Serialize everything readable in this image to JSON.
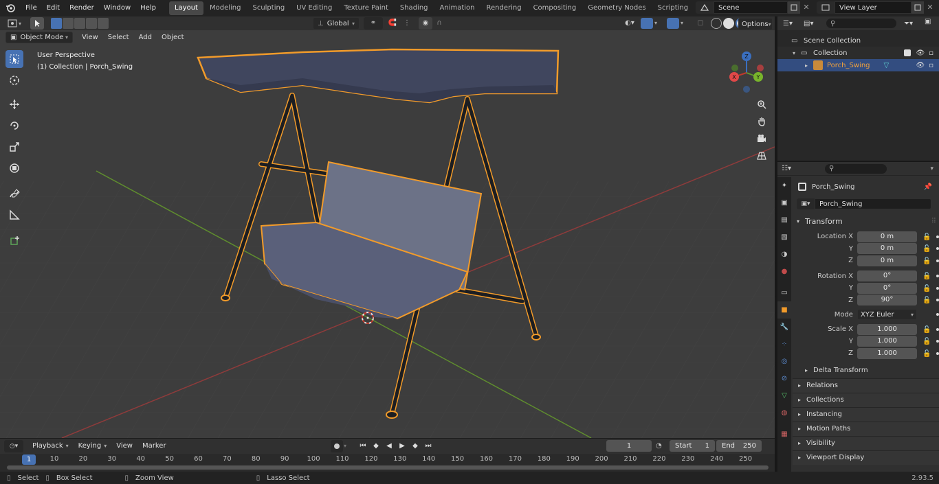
{
  "topbar": {
    "menu": [
      "File",
      "Edit",
      "Render",
      "Window",
      "Help"
    ],
    "workspaces": [
      "Layout",
      "Modeling",
      "Sculpting",
      "UV Editing",
      "Texture Paint",
      "Shading",
      "Animation",
      "Rendering",
      "Compositing",
      "Geometry Nodes",
      "Scripting"
    ],
    "active_workspace": "Layout",
    "scene": "Scene",
    "view_layer": "View Layer"
  },
  "viewport_header": {
    "mode": "Object Mode",
    "menus": [
      "View",
      "Select",
      "Add",
      "Object"
    ],
    "orientation": "Global",
    "options_label": "Options"
  },
  "viewport": {
    "perspective_label": "User Perspective",
    "collection_label": "(1) Collection | Porch_Swing",
    "gizmo_axes": {
      "x": "X",
      "y": "Y",
      "z": "Z"
    },
    "colors": {
      "selection": "#f29b2a",
      "grid_x": "#8f3b3b",
      "grid_y": "#5f8d2e",
      "active_tool": "#4772b3"
    },
    "tools": [
      "select-box",
      "cursor",
      "move",
      "rotate",
      "scale",
      "transform",
      "annotate",
      "measure",
      "add-cube"
    ]
  },
  "outliner": {
    "rows": [
      {
        "label": "Scene Collection"
      },
      {
        "label": "Collection"
      },
      {
        "label": "Porch_Swing"
      }
    ]
  },
  "properties": {
    "object_name": "Porch_Swing",
    "datablock_name": "Porch_Swing",
    "transform_label": "Transform",
    "location_label": "Location X",
    "rotation_label": "Rotation X",
    "scale_label": "Scale X",
    "y_label": "Y",
    "z_label": "Z",
    "location": [
      "0 m",
      "0 m",
      "0 m"
    ],
    "rotation": [
      "0°",
      "0°",
      "90°"
    ],
    "mode_label": "Mode",
    "mode_value": "XYZ Euler",
    "scale": [
      "1.000",
      "1.000",
      "1.000"
    ],
    "delta_transform": "Delta Transform",
    "panels": [
      "Relations",
      "Collections",
      "Instancing",
      "Motion Paths",
      "Visibility",
      "Viewport Display"
    ]
  },
  "timeline": {
    "menus": [
      "Playback",
      "Keying",
      "View",
      "Marker"
    ],
    "current_frame": "1",
    "start_label": "Start",
    "start_value": "1",
    "end_label": "End",
    "end_value": "250",
    "ruler_current": "1",
    "ruler": [
      "10",
      "20",
      "30",
      "40",
      "50",
      "60",
      "70",
      "80",
      "90",
      "100",
      "110",
      "120",
      "130",
      "140",
      "150",
      "160",
      "170",
      "180",
      "190",
      "200",
      "210",
      "220",
      "230",
      "240",
      "250"
    ]
  },
  "statusbar": {
    "select": "Select",
    "box_select": "Box Select",
    "zoom_view": "Zoom View",
    "lasso_select": "Lasso Select",
    "version": "2.93.5"
  }
}
